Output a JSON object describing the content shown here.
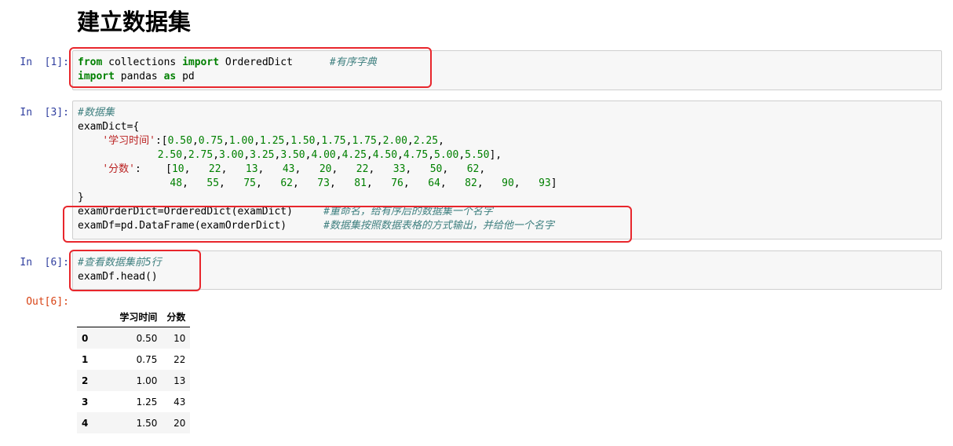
{
  "heading": "建立数据集",
  "cells": [
    {
      "prompt": "In  [1]:",
      "lines": [
        [
          {
            "t": "from",
            "c": "kw"
          },
          {
            "t": " collections "
          },
          {
            "t": "import",
            "c": "kw"
          },
          {
            "t": " OrderedDict      "
          },
          {
            "t": "#有序字典",
            "c": "cm"
          }
        ],
        [
          {
            "t": "import",
            "c": "kw"
          },
          {
            "t": " pandas "
          },
          {
            "t": "as",
            "c": "kw"
          },
          {
            "t": " pd"
          }
        ]
      ]
    },
    {
      "prompt": "In  [3]:",
      "lines": [
        [
          {
            "t": "#数据集",
            "c": "cm"
          }
        ],
        [
          {
            "t": "examDict={"
          }
        ],
        [
          {
            "t": "    "
          },
          {
            "t": "'学习时间'",
            "c": "str"
          },
          {
            "t": ":["
          },
          {
            "t": "0.50",
            "c": "num"
          },
          {
            "t": ","
          },
          {
            "t": "0.75",
            "c": "num"
          },
          {
            "t": ","
          },
          {
            "t": "1.00",
            "c": "num"
          },
          {
            "t": ","
          },
          {
            "t": "1.25",
            "c": "num"
          },
          {
            "t": ","
          },
          {
            "t": "1.50",
            "c": "num"
          },
          {
            "t": ","
          },
          {
            "t": "1.75",
            "c": "num"
          },
          {
            "t": ","
          },
          {
            "t": "1.75",
            "c": "num"
          },
          {
            "t": ","
          },
          {
            "t": "2.00",
            "c": "num"
          },
          {
            "t": ","
          },
          {
            "t": "2.25",
            "c": "num"
          },
          {
            "t": ","
          }
        ],
        [
          {
            "t": "             "
          },
          {
            "t": "2.50",
            "c": "num"
          },
          {
            "t": ","
          },
          {
            "t": "2.75",
            "c": "num"
          },
          {
            "t": ","
          },
          {
            "t": "3.00",
            "c": "num"
          },
          {
            "t": ","
          },
          {
            "t": "3.25",
            "c": "num"
          },
          {
            "t": ","
          },
          {
            "t": "3.50",
            "c": "num"
          },
          {
            "t": ","
          },
          {
            "t": "4.00",
            "c": "num"
          },
          {
            "t": ","
          },
          {
            "t": "4.25",
            "c": "num"
          },
          {
            "t": ","
          },
          {
            "t": "4.50",
            "c": "num"
          },
          {
            "t": ","
          },
          {
            "t": "4.75",
            "c": "num"
          },
          {
            "t": ","
          },
          {
            "t": "5.00",
            "c": "num"
          },
          {
            "t": ","
          },
          {
            "t": "5.50",
            "c": "num"
          },
          {
            "t": "],"
          }
        ],
        [
          {
            "t": "    "
          },
          {
            "t": "'分数'",
            "c": "str"
          },
          {
            "t": ":    ["
          },
          {
            "t": "10",
            "c": "num"
          },
          {
            "t": ",   "
          },
          {
            "t": "22",
            "c": "num"
          },
          {
            "t": ",   "
          },
          {
            "t": "13",
            "c": "num"
          },
          {
            "t": ",   "
          },
          {
            "t": "43",
            "c": "num"
          },
          {
            "t": ",   "
          },
          {
            "t": "20",
            "c": "num"
          },
          {
            "t": ",   "
          },
          {
            "t": "22",
            "c": "num"
          },
          {
            "t": ",   "
          },
          {
            "t": "33",
            "c": "num"
          },
          {
            "t": ",   "
          },
          {
            "t": "50",
            "c": "num"
          },
          {
            "t": ",   "
          },
          {
            "t": "62",
            "c": "num"
          },
          {
            "t": ","
          }
        ],
        [
          {
            "t": "               "
          },
          {
            "t": "48",
            "c": "num"
          },
          {
            "t": ",   "
          },
          {
            "t": "55",
            "c": "num"
          },
          {
            "t": ",   "
          },
          {
            "t": "75",
            "c": "num"
          },
          {
            "t": ",   "
          },
          {
            "t": "62",
            "c": "num"
          },
          {
            "t": ",   "
          },
          {
            "t": "73",
            "c": "num"
          },
          {
            "t": ",   "
          },
          {
            "t": "81",
            "c": "num"
          },
          {
            "t": ",   "
          },
          {
            "t": "76",
            "c": "num"
          },
          {
            "t": ",   "
          },
          {
            "t": "64",
            "c": "num"
          },
          {
            "t": ",   "
          },
          {
            "t": "82",
            "c": "num"
          },
          {
            "t": ",   "
          },
          {
            "t": "90",
            "c": "num"
          },
          {
            "t": ",   "
          },
          {
            "t": "93",
            "c": "num"
          },
          {
            "t": "]"
          }
        ],
        [
          {
            "t": "}"
          }
        ],
        [
          {
            "t": "examOrderDict=OrderedDict(examDict)     "
          },
          {
            "t": "#重命名，给有序后的数据集一个名字",
            "c": "cm"
          }
        ],
        [
          {
            "t": "examDf=pd.DataFrame(examOrderDict)      "
          },
          {
            "t": "#数据集按照数据表格的方式输出，并给他一个名字",
            "c": "cm"
          }
        ]
      ]
    },
    {
      "prompt": "In  [6]:",
      "lines": [
        [
          {
            "t": "#查看数据集前5行",
            "c": "cm"
          }
        ],
        [
          {
            "t": "examDf.head()"
          }
        ]
      ]
    }
  ],
  "output_prompt": "Out[6]:",
  "table": {
    "columns": [
      "学习时间",
      "分数"
    ],
    "rows": [
      {
        "index": "0",
        "values": [
          "0.50",
          "10"
        ]
      },
      {
        "index": "1",
        "values": [
          "0.75",
          "22"
        ]
      },
      {
        "index": "2",
        "values": [
          "1.00",
          "13"
        ]
      },
      {
        "index": "3",
        "values": [
          "1.25",
          "43"
        ]
      },
      {
        "index": "4",
        "values": [
          "1.50",
          "20"
        ]
      }
    ]
  },
  "colors": {
    "annotation": "#e8262c",
    "prompt_in": "#303f9f",
    "prompt_out": "#d84315"
  }
}
